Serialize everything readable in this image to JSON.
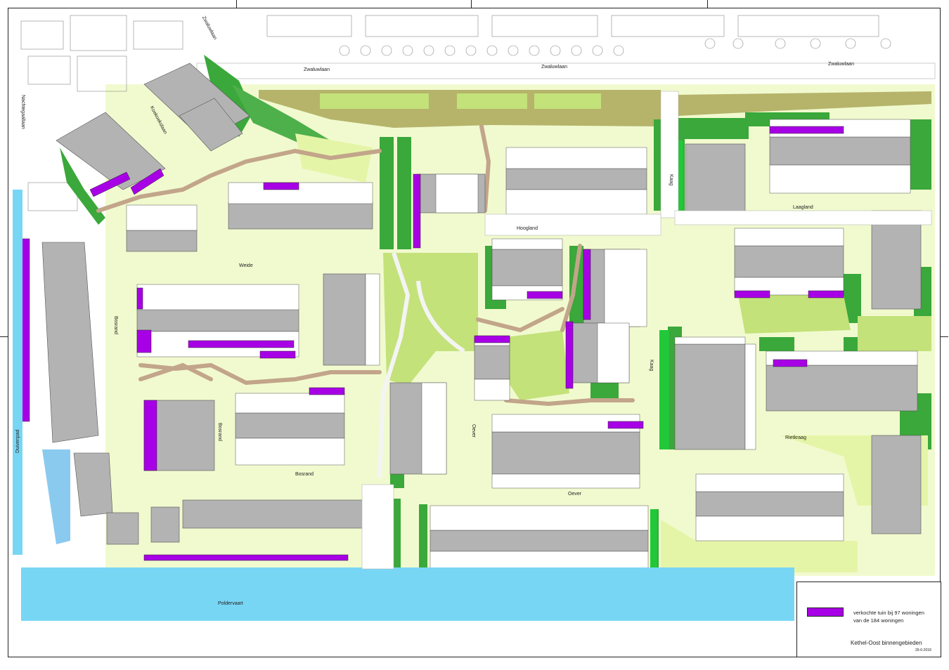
{
  "colors": {
    "building": "#b3b3b3",
    "light_green": "#e5f5a8",
    "mid_green": "#c3e27a",
    "dark_green": "#3aa83a",
    "bright_green": "#22c83a",
    "olive": "#b5b46a",
    "path_brown": "#c2a58a",
    "water": "#78d6f5",
    "sold_garden": "#a800e6",
    "canal_blue": "#5ab4e8"
  },
  "streets": {
    "zwaluwlaan": "Zwaluwlaan",
    "nachtegaallaan": "Nachtegaallaan",
    "koekoekslaan": "Koekoekslaan",
    "weide": "Weide",
    "bosrand": "Bosrand",
    "hoogland": "Hoogland",
    "laagland": "Laagland",
    "kaag": "Kaag",
    "oever": "Oever",
    "rietkraag": "Rietkraag",
    "duivenpad": "Duivenpad",
    "poldervaart": "Poldervaart"
  },
  "legend": {
    "line1": "verkochte tuin bij 97 woningen",
    "line2": "van de 184 woningen",
    "title": "Kethel-Oost binnengebieden",
    "date": "26-6-2018"
  }
}
